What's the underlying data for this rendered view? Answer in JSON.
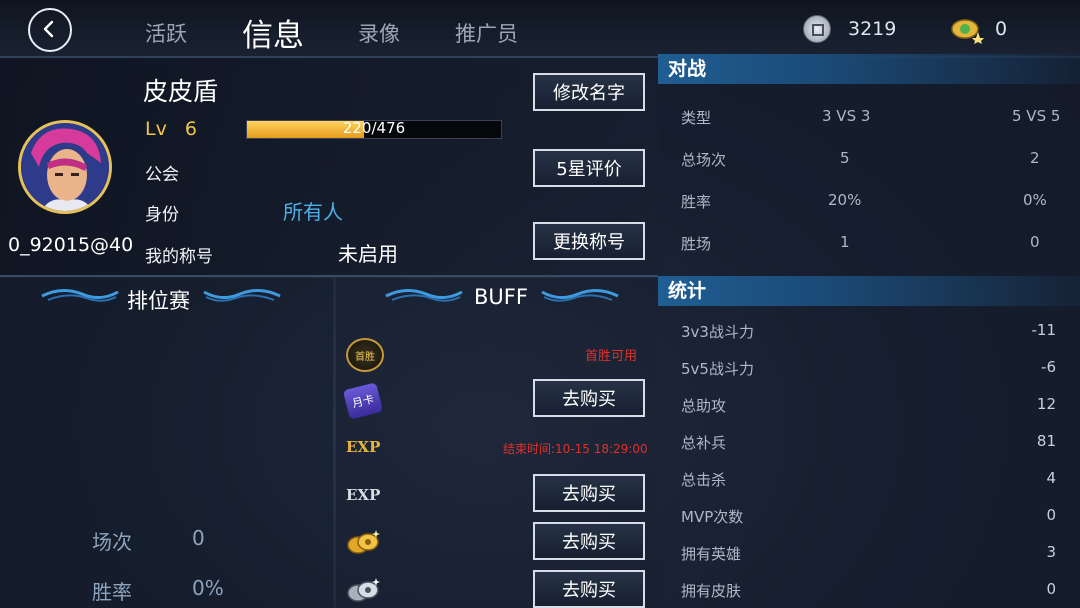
{
  "header": {
    "tabs": [
      {
        "label": "活跃"
      },
      {
        "label": "信息"
      },
      {
        "label": "录像"
      },
      {
        "label": "推广员"
      }
    ],
    "coins": "3219",
    "gems": "0"
  },
  "profile": {
    "name": "皮皮盾",
    "level_prefix": "Lv",
    "level": "6",
    "xp_text_current": "220",
    "xp_text_total": "/476",
    "xp_fraction": 0.46,
    "guild_label": "公会",
    "identity_label": "身份",
    "identity_value": "所有人",
    "title_label": "我的称号",
    "title_value": "未启用",
    "user_id": "0_92015@40",
    "buttons": {
      "rename": "修改名字",
      "rating": "5星评价",
      "change_title": "更换称号"
    }
  },
  "ranked": {
    "title": "排位赛",
    "matches_label": "场次",
    "matches_value": "0",
    "winrate_label": "胜率",
    "winrate_value": "0%"
  },
  "buff": {
    "title": "BUFF",
    "rows": [
      {
        "icon": "first-win-icon",
        "text": "首胜可用"
      },
      {
        "icon": "monthly-card-icon",
        "button": "去购买"
      },
      {
        "icon": "exp-gold-icon",
        "text": "结束时间:10-15 18:29:00"
      },
      {
        "icon": "exp-silver-icon",
        "button": "去购买"
      },
      {
        "icon": "gold-coin-icon",
        "button": "去购买"
      },
      {
        "icon": "silver-coin-icon",
        "button": "去购买"
      }
    ],
    "icon_labels": {
      "first_win": "首胜",
      "monthly": "月卡",
      "exp": "EXP"
    }
  },
  "battle": {
    "title": "对战",
    "header": {
      "label": "类型",
      "c1": "3 VS 3",
      "c2": "5 VS 5"
    },
    "rows": [
      {
        "label": "总场次",
        "c1": "5",
        "c2": "2"
      },
      {
        "label": "胜率",
        "c1": "20%",
        "c2": "0%"
      },
      {
        "label": "胜场",
        "c1": "1",
        "c2": "0"
      }
    ]
  },
  "stats": {
    "title": "统计",
    "rows": [
      {
        "label": "3v3战斗力",
        "value": "-11"
      },
      {
        "label": "5v5战斗力",
        "value": "-6"
      },
      {
        "label": "总助攻",
        "value": "12"
      },
      {
        "label": "总补兵",
        "value": "81"
      },
      {
        "label": "总击杀",
        "value": "4"
      },
      {
        "label": "MVP次数",
        "value": "0"
      },
      {
        "label": "拥有英雄",
        "value": "3"
      },
      {
        "label": "拥有皮肤",
        "value": "0"
      }
    ]
  },
  "colors": {
    "accent_blue": "#1f5e93",
    "xp_gold": "#f0b232",
    "buff_red": "#e0302a",
    "identity_blue": "#4fb0e8",
    "level_gold": "#f2c64a"
  }
}
